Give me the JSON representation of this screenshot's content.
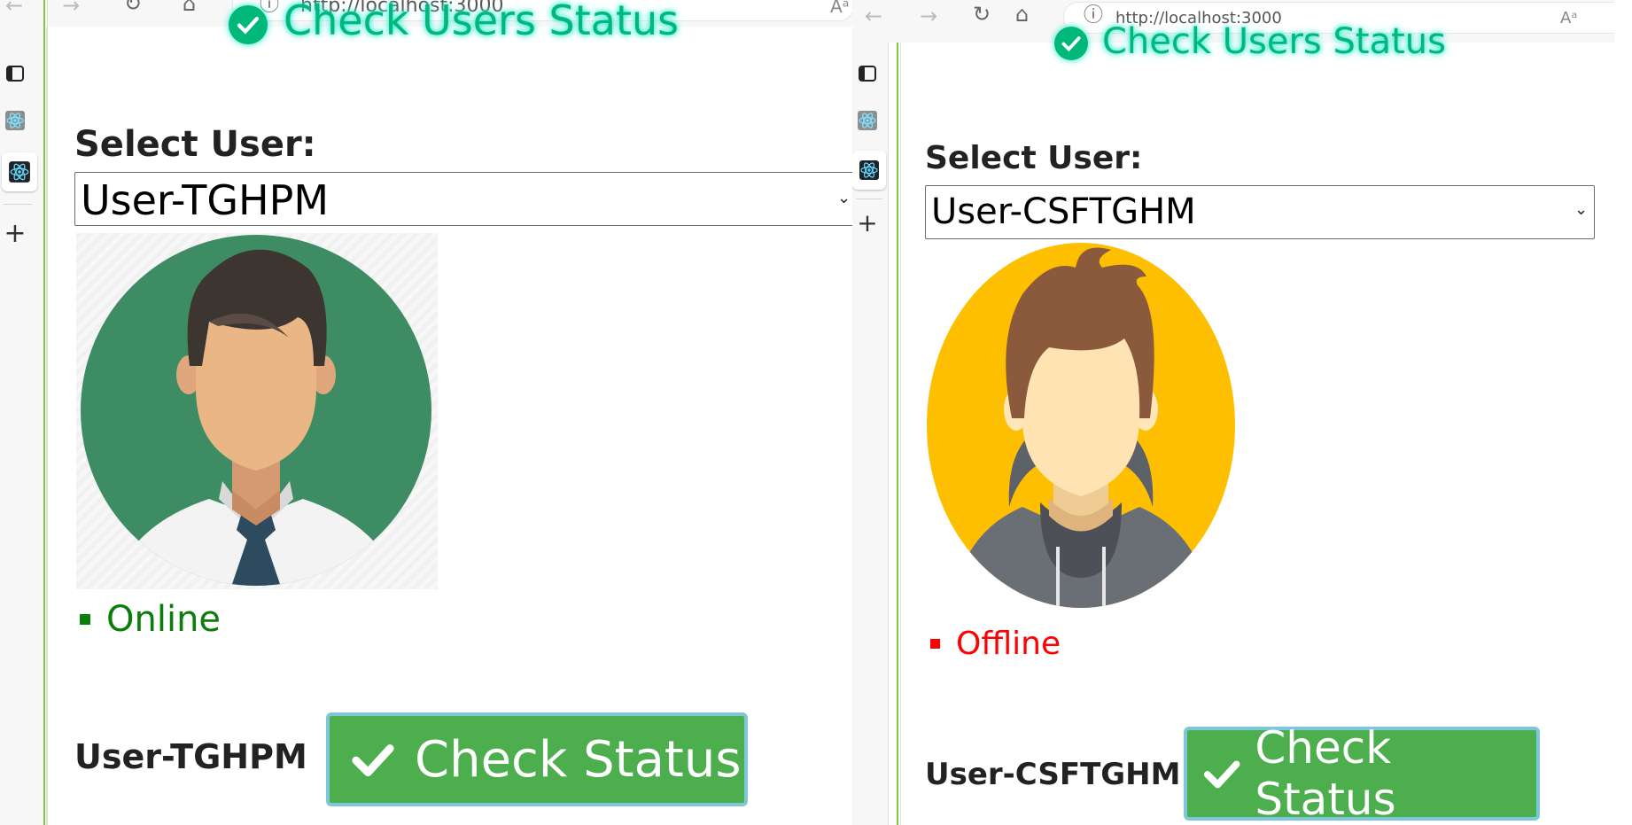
{
  "browser": {
    "url": "http://localhost:3000",
    "info_icon": "info-icon",
    "read_aloud_label": "Aᵃ",
    "icons": [
      "back-arrow-icon",
      "forward-arrow-icon",
      "refresh-icon",
      "home-icon",
      "search-icon",
      "extensions-icon"
    ]
  },
  "sidebar": {
    "icons": [
      "tab-actions-icon",
      "react-devtools-icon",
      "react-icon-selected",
      "plus-icon"
    ],
    "plus_label": "+"
  },
  "page": {
    "title": "Check Users Status",
    "select_label": "Select User:",
    "check_button_label": "Check Status",
    "check_icon": "checkmark-icon"
  },
  "panes": [
    {
      "selected_user": "User-TGHPM",
      "status": "Online",
      "status_color": "#0a7d0a",
      "avatar": "businessman-avatar",
      "name_label": "User-TGHPM"
    },
    {
      "selected_user": "User-CSFTGHM",
      "status": "Offline",
      "status_color": "#ff0000",
      "avatar": "hoodie-avatar",
      "name_label": "User-CSFTGHM"
    }
  ]
}
